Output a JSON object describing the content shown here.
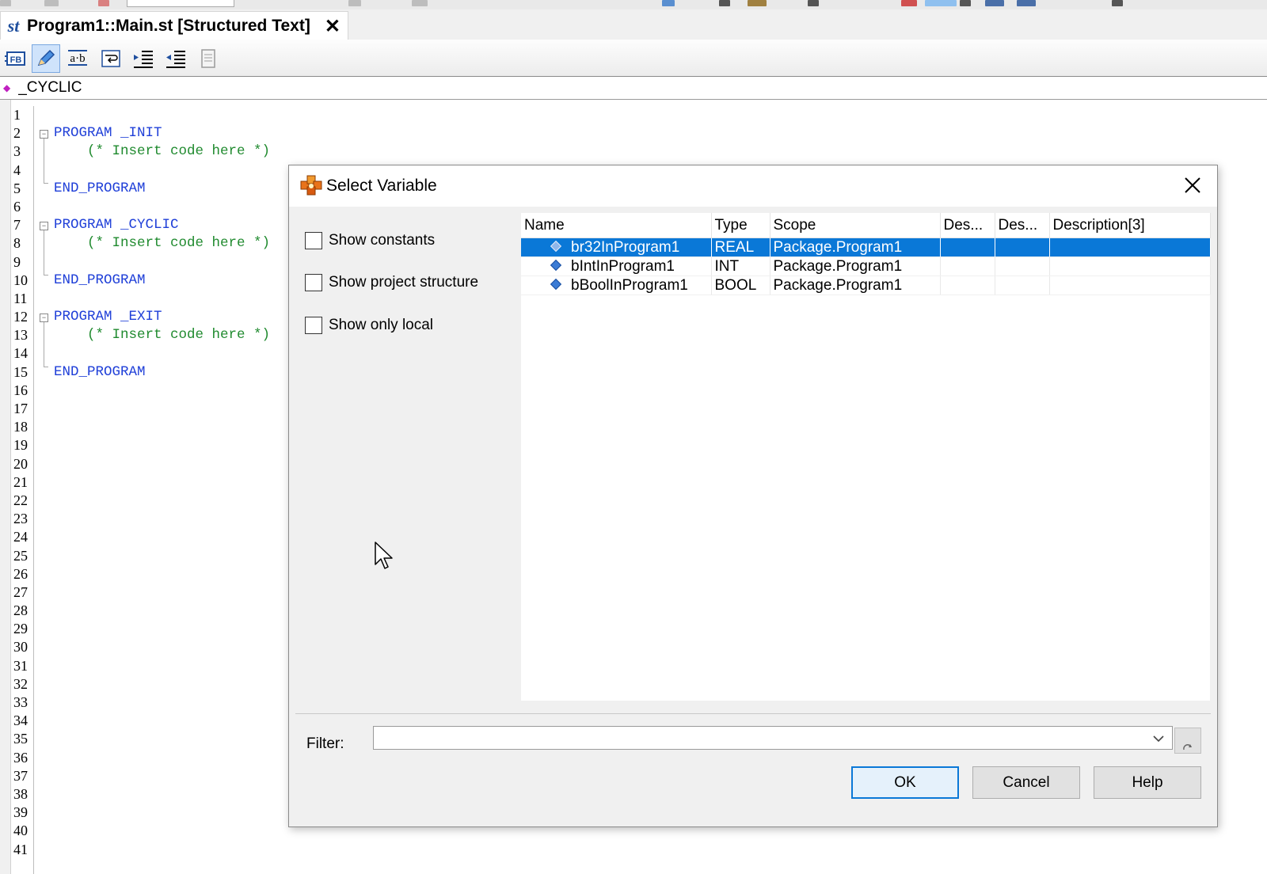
{
  "tab": {
    "icon_label": "st",
    "title": "Program1::Main.st [Structured Text]",
    "close_label": "✕"
  },
  "toolbar": {
    "buttons": [
      {
        "id": "fb",
        "icon": "function-block-icon"
      },
      {
        "id": "pin",
        "icon": "pencil-icon"
      },
      {
        "id": "ab",
        "icon": "ab-text-icon"
      },
      {
        "id": "wrap",
        "icon": "word-wrap-icon"
      },
      {
        "id": "indent",
        "icon": "indent-icon"
      },
      {
        "id": "outdent",
        "icon": "outdent-icon"
      },
      {
        "id": "doc",
        "icon": "document-icon"
      }
    ]
  },
  "breadcrumb": {
    "text": "_CYCLIC"
  },
  "editor": {
    "line_count": 41,
    "lines": [
      "",
      "PROGRAM _INIT",
      "    (* Insert code here *)",
      "",
      "END_PROGRAM",
      "",
      "PROGRAM _CYCLIC",
      "    (* Insert code here *)",
      "",
      "END_PROGRAM",
      "",
      "PROGRAM _EXIT",
      "    (* Insert code here *)",
      "",
      "END_PROGRAM"
    ]
  },
  "dialog": {
    "title": "Select Variable",
    "options": [
      {
        "label": "Show constants",
        "checked": false
      },
      {
        "label": "Show project structure",
        "checked": false
      },
      {
        "label": "Show only local",
        "checked": false
      }
    ],
    "columns": [
      "Name",
      "Type",
      "Scope",
      "Des...",
      "Des...",
      "Description[3]"
    ],
    "rows": [
      {
        "name": "br32InProgram1",
        "type": "REAL",
        "scope": "Package.Program1",
        "d1": "",
        "d2": "",
        "d3": "",
        "selected": true
      },
      {
        "name": "bIntInProgram1",
        "type": "INT",
        "scope": "Package.Program1",
        "d1": "",
        "d2": "",
        "d3": "",
        "selected": false
      },
      {
        "name": "bBoolInProgram1",
        "type": "BOOL",
        "scope": "Package.Program1",
        "d1": "",
        "d2": "",
        "d3": "",
        "selected": false
      }
    ],
    "filter": {
      "label": "Filter:",
      "value": ""
    },
    "buttons": {
      "ok": "OK",
      "cancel": "Cancel",
      "help": "Help"
    }
  },
  "colors": {
    "selection": "#0a78d7",
    "keyword": "#1f3fd8",
    "comment": "#1f8a2e"
  }
}
